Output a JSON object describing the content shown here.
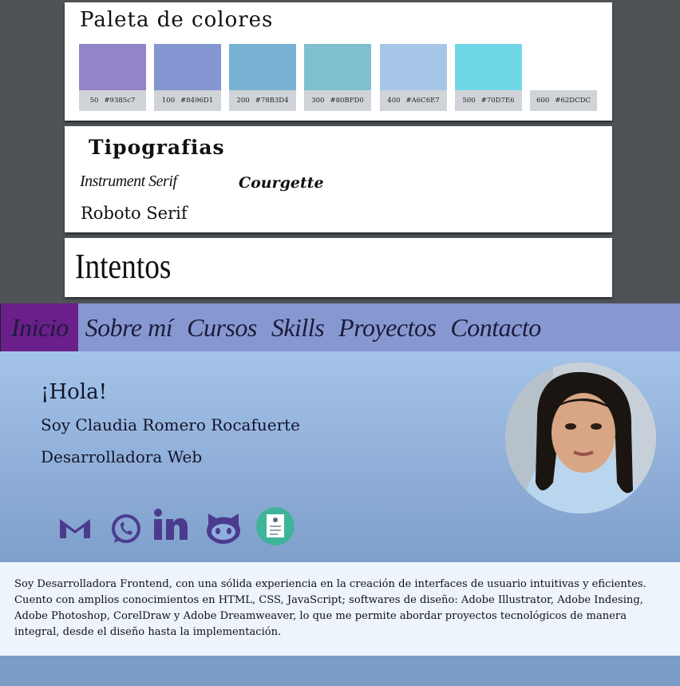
{
  "palette": {
    "title": "Paleta de colores",
    "swatches": [
      {
        "num": "50",
        "hex_label": "#9385c7",
        "color": "#9385c7",
        "shown": true
      },
      {
        "num": "100",
        "hex_label": "#8496D1",
        "color": "#8496D1",
        "shown": true
      },
      {
        "num": "200",
        "hex_label": "#78B3D4",
        "color": "#78B3D4",
        "shown": true
      },
      {
        "num": "300",
        "hex_label": "#80BFD0",
        "color": "#80BFD0",
        "shown": true
      },
      {
        "num": "400",
        "hex_label": "#A6C6E7",
        "color": "#A6C6E7",
        "shown": true
      },
      {
        "num": "500",
        "hex_label": "#70D7E6",
        "color": "#70D7E6",
        "shown": true
      },
      {
        "num": "600",
        "hex_label": "#62DCDC",
        "color": "#62DCDC",
        "shown": false
      }
    ]
  },
  "typography": {
    "title": "Tipografias",
    "fonts": [
      "Instrument Serif",
      "Courgette",
      "Roboto Serif"
    ]
  },
  "intentos": {
    "title": "Intentos"
  },
  "site": {
    "nav": [
      "Inicio",
      "Sobre mí",
      "Cursos",
      "Skills",
      "Proyectos",
      "Contacto"
    ],
    "nav_active": "Inicio",
    "hero": {
      "greeting": "¡Hola!",
      "name": "Soy Claudia Romero Rocafuerte",
      "role": "Desarrolladora Web"
    },
    "social_icons": [
      "gmail-icon",
      "whatsapp-icon",
      "linkedin-icon",
      "github-icon",
      "resume-icon"
    ],
    "about": "Soy Desarrolladora Frontend, con una sólida experiencia en la creación de interfaces de usuario intuitivas y eficientes. Cuento con amplios conocimientos en HTML, CSS, JavaScript; softwares de diseño: Adobe Illustrator, Adobe Indesing, Adobe Photoshop, CorelDraw y Adobe Dreamweaver, lo que me permite abordar proyectos tecnológicos de manera integral, desde el diseño hasta la implementación."
  },
  "colors": {
    "nav_bg": "#8798d1",
    "nav_active_bg": "#6b1f8a",
    "icon_purple": "#4b3b8f",
    "resume_green": "#3fb49a"
  }
}
